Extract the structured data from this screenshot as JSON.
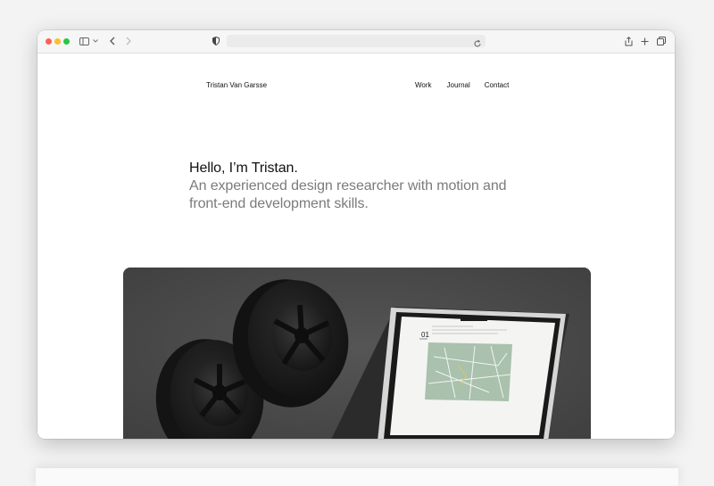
{
  "browser": {
    "url": "",
    "icons": [
      "sidebar-icon",
      "chevron-down-icon",
      "back-icon",
      "forward-icon",
      "shield-icon",
      "reload-icon",
      "share-icon",
      "plus-icon",
      "tabs-icon"
    ]
  },
  "site": {
    "name": "Tristan Van Garsse",
    "nav": [
      "Work",
      "Journal",
      "Contact"
    ]
  },
  "hero": {
    "title": "Hello, I’m Tristan.",
    "subtitle": "An experienced design researcher with motion and front-end development skills."
  },
  "feature": {
    "screen_number": "01"
  },
  "colors": {
    "text": "#111111",
    "muted": "#7b7b7b",
    "card_bg": "#4a4949",
    "map_green": "#a9c1ad"
  }
}
